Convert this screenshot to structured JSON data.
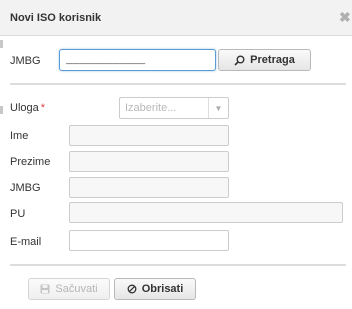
{
  "dialog": {
    "title": "Novi ISO korisnik",
    "close_icon": "close-icon"
  },
  "search": {
    "jmbg_label": "JMBG",
    "jmbg_value": "____________",
    "search_button_label": "Pretraga",
    "search_icon": "search-icon"
  },
  "form": {
    "role_label": "Uloga",
    "required_mark": "*",
    "role_placeholder": "Izaberite...",
    "first_name_label": "Ime",
    "last_name_label": "Prezime",
    "jmbg_label": "JMBG",
    "pu_label": "PU",
    "email_label": "E-mail"
  },
  "footer": {
    "save_label": "Sačuvati",
    "save_icon": "save-icon",
    "delete_label": "Obrisati",
    "delete_icon": "cancel-icon"
  },
  "colors": {
    "required": "#e04040",
    "focus_border": "#5b9bd5",
    "titlebar_bg": "#f2f2f2"
  }
}
